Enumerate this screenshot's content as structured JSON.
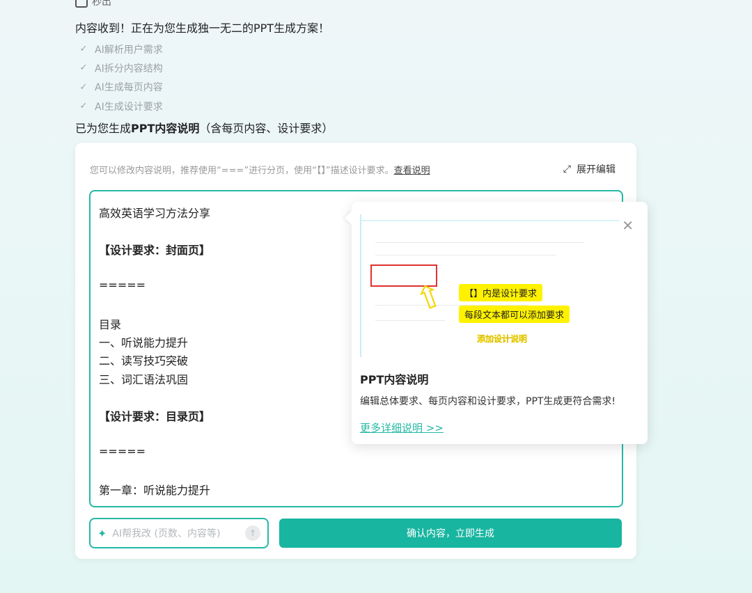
{
  "top_fragment": "秒出",
  "headline": "内容收到！正在为您生成独一无二的PPT生成方案！",
  "steps": [
    {
      "label": "AI解析用户需求"
    },
    {
      "label": "AI拆分内容结构"
    },
    {
      "label": "AI生成每页内容"
    },
    {
      "label": "AI生成设计要求"
    }
  ],
  "subline": {
    "prefix": "已为您生成",
    "bold": "PPT内容说明",
    "suffix": "（含每页内容、设计要求）"
  },
  "card": {
    "hint_text": "您可以修改内容说明，推荐使用“===”进行分页，使用“【】”描述设计要求。",
    "hint_link": "查看说明",
    "expand_label": "展开编辑",
    "editor_lines": [
      "高效英语学习方法分享",
      "【设计要求：封面页】",
      "=====",
      "目录",
      "一、听说能力提升",
      "二、读写技巧突破",
      "三、词汇语法巩固",
      "【设计要求：目录页】",
      "=====",
      "第一章：听说能力提升"
    ],
    "ai_placeholder": "AI帮我改 (页数、内容等)",
    "confirm_label": "确认内容，立即生成"
  },
  "popover": {
    "tag1": "【】内是设计要求",
    "tag2": "每段文本都可以添加要求",
    "tag3": "添加设计说明",
    "title": "PPT内容说明",
    "desc": "编辑总体要求、每页内容和设计要求，PPT生成更符合需求!",
    "link": "更多详细说明 >>"
  },
  "colors": {
    "accent": "#18b5a0",
    "border": "#25b9a6",
    "highlight": "#fff200"
  }
}
